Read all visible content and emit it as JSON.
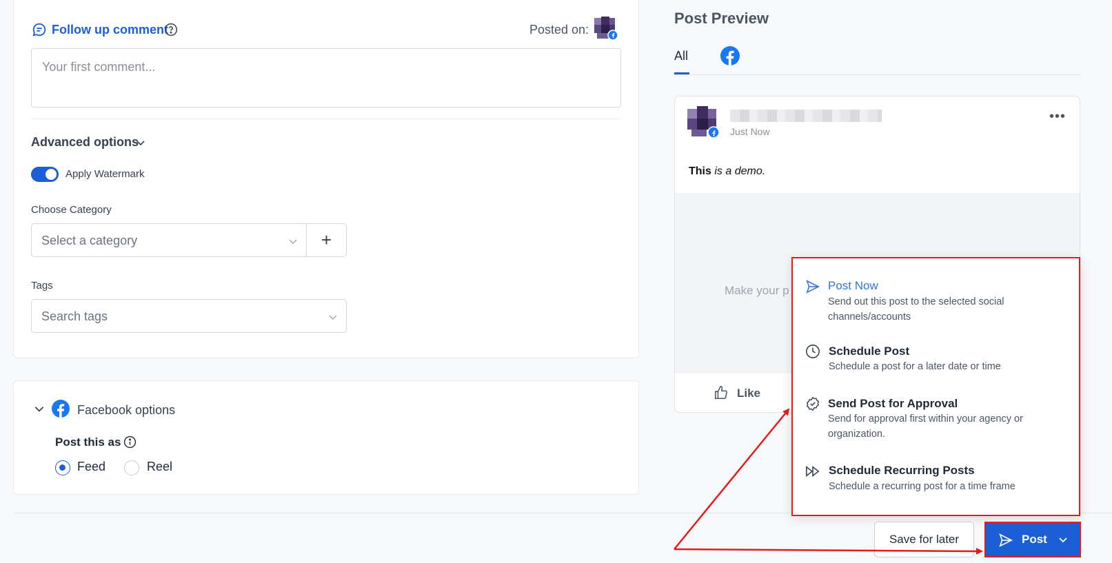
{
  "follow_up": {
    "label": "Follow up comment",
    "posted_on_label": "Posted on:",
    "comment_placeholder": "Your first comment..."
  },
  "advanced": {
    "label": "Advanced options",
    "watermark_label": "Apply Watermark",
    "watermark_on": true,
    "category_label": "Choose Category",
    "category_placeholder": "Select a category",
    "category_add": "+",
    "tags_label": "Tags",
    "tags_placeholder": "Search tags"
  },
  "facebook_options": {
    "label": "Facebook options",
    "post_as_label": "Post this as",
    "options": [
      "Feed",
      "Reel"
    ],
    "selected": "Feed"
  },
  "preview": {
    "title": "Post Preview",
    "tab_all": "All",
    "time": "Just Now",
    "more": "•••",
    "text_bold": "This",
    "text_italic": "is a demo.",
    "media_placeholder": "Make your p",
    "like_label": "Like"
  },
  "menu": {
    "items": [
      {
        "icon": "send-icon",
        "title": "Post Now",
        "desc": "Send out this post to the selected social channels/accounts"
      },
      {
        "icon": "clock-icon",
        "title": "Schedule Post",
        "desc": "Schedule a post for a later date or time"
      },
      {
        "icon": "badge-check-icon",
        "title": "Send Post for Approval",
        "desc": "Send for approval first within your agency or organization."
      },
      {
        "icon": "fast-forward-icon",
        "title": "Schedule Recurring Posts",
        "desc": "Schedule a recurring post for a time frame"
      }
    ]
  },
  "footer": {
    "save_label": "Save for later",
    "post_label": "Post"
  },
  "colors": {
    "primary": "#1a5fd6",
    "annotation_red": "#e41b1b",
    "facebook_blue": "#1877f2"
  }
}
